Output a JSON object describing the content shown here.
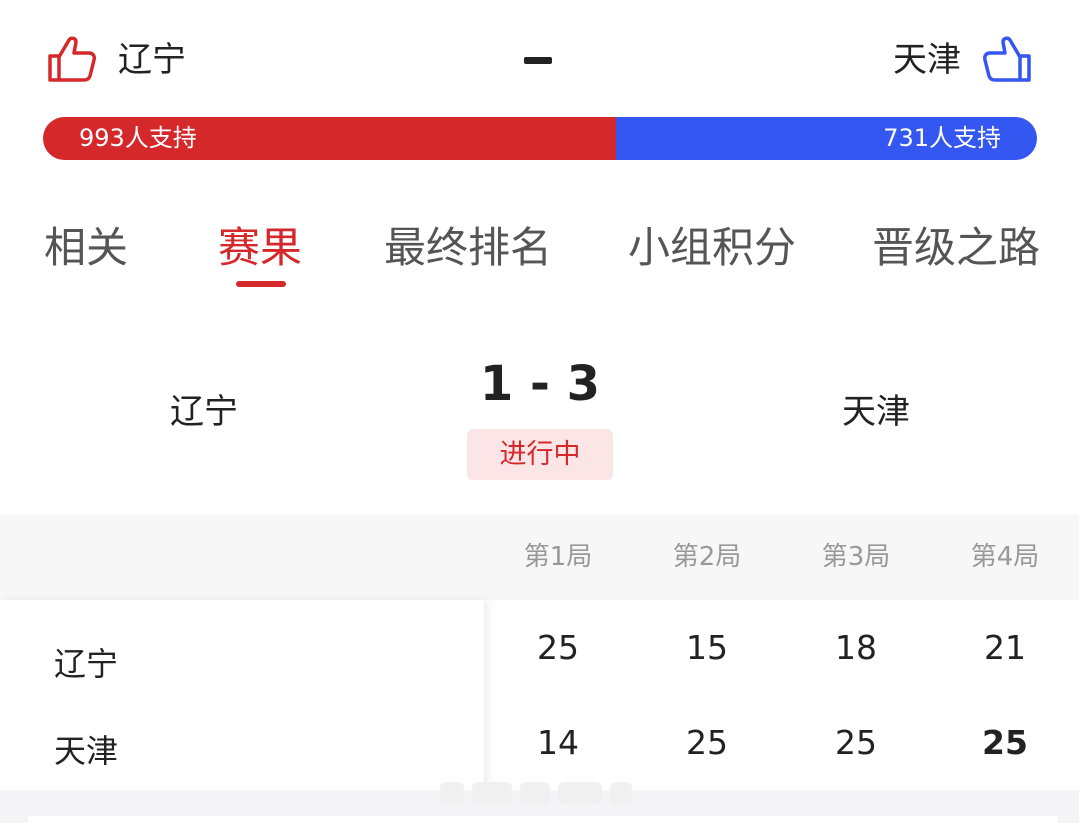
{
  "support": {
    "home_team": "辽宁",
    "away_team": "天津",
    "home_count_text": "993人支持",
    "away_count_text": "731人支持",
    "home_votes": 993,
    "away_votes": 731,
    "home_color": "#d5282b",
    "away_color": "#3357f0",
    "home_icon": "thumbs-up-icon",
    "away_icon": "thumbs-up-icon"
  },
  "tabs": [
    {
      "label": "相关",
      "active": false
    },
    {
      "label": "赛果",
      "active": true
    },
    {
      "label": "最终排名",
      "active": false
    },
    {
      "label": "小组积分",
      "active": false
    },
    {
      "label": "晋级之路",
      "active": false
    }
  ],
  "match": {
    "home_team": "辽宁",
    "away_team": "天津",
    "score": "1 - 3",
    "status": "进行中"
  },
  "sets_table": {
    "headers": [
      "第1局",
      "第2局",
      "第3局",
      "第4局"
    ],
    "rows": [
      {
        "team": "辽宁",
        "scores": [
          "25",
          "15",
          "18",
          "21"
        ]
      },
      {
        "team": "天津",
        "scores": [
          "14",
          "25",
          "25",
          "25"
        ]
      }
    ]
  }
}
